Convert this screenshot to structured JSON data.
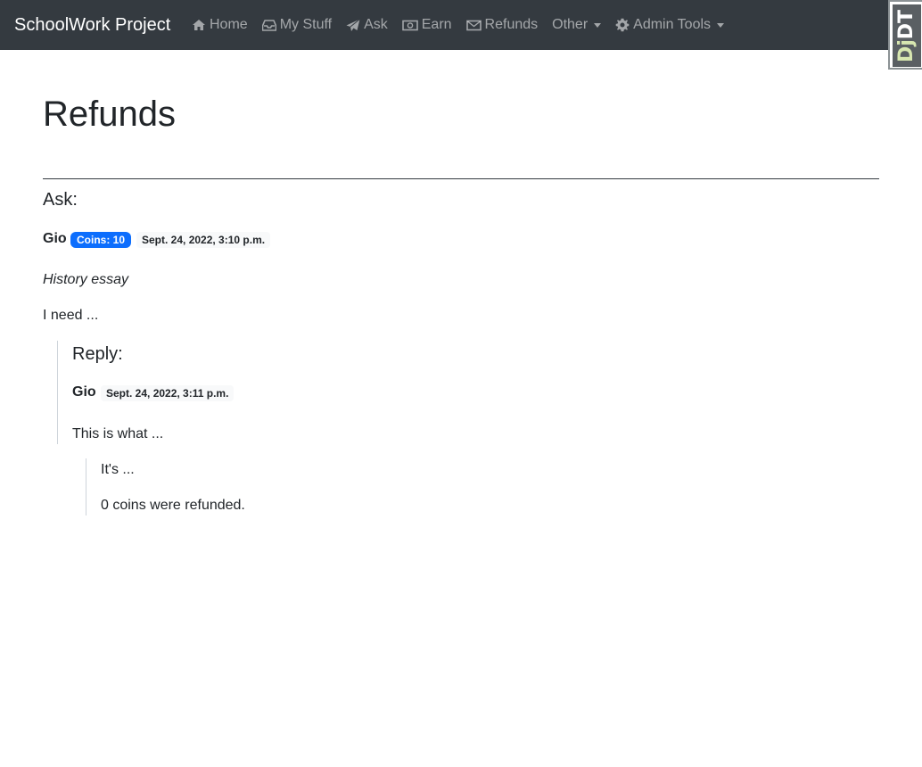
{
  "navbar": {
    "brand": "SchoolWork Project",
    "items": [
      {
        "label": "Home",
        "icon": "home-icon"
      },
      {
        "label": "My Stuff",
        "icon": "inbox-icon"
      },
      {
        "label": "Ask",
        "icon": "paper-plane-icon"
      },
      {
        "label": "Earn",
        "icon": "money-bill-icon"
      },
      {
        "label": "Refunds",
        "icon": "envelope-icon"
      },
      {
        "label": "Other",
        "icon": null,
        "dropdown": true
      },
      {
        "label": "Admin Tools",
        "icon": "gear-icon",
        "dropdown": true
      }
    ]
  },
  "debug_toolbar": {
    "label_dj": "Dj",
    "label_dt": "DT"
  },
  "page": {
    "title": "Refunds"
  },
  "ask": {
    "heading": "Ask:",
    "user": "Gio",
    "coins_badge": "Coins: 10",
    "date": "Sept. 24, 2022, 3:10 p.m.",
    "subject": "History essay",
    "body": "I need ..."
  },
  "reply": {
    "heading": "Reply:",
    "user": "Gio",
    "date": "Sept. 24, 2022, 3:11 p.m.",
    "body": "This is what ..."
  },
  "refund": {
    "reason": "It's ...",
    "result": "0 coins were refunded."
  },
  "colors": {
    "navbar_bg": "#343a40",
    "badge_primary": "#0d6efd"
  }
}
